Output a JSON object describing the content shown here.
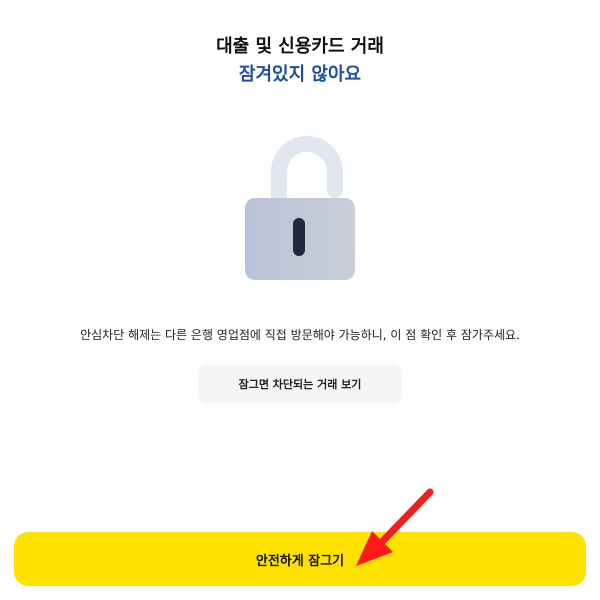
{
  "header": {
    "title": "대출 및 신용카드 거래",
    "status": "잠겨있지 않아요"
  },
  "lock": {
    "icon": "unlocked-padlock-icon",
    "state": "unlocked"
  },
  "description": "안심차단 해제는 다른 은행 영업점에 직접 방문해야 가능하니, 이 점 확인 후 잠가주세요.",
  "buttons": {
    "view_blocked": "잠그면 차단되는 거래 보기",
    "lock_safely": "안전하게 잠그기"
  },
  "annotation": {
    "icon": "red-arrow-icon"
  },
  "colors": {
    "status_blue": "#1f4f9e",
    "primary_yellow": "#ffe100",
    "arrow_red": "#ff1a1a",
    "lock_body_start": "#b9c3d8",
    "lock_body_end": "#c9ced7",
    "shackle": "#e2e6ef",
    "keyhole": "#1f2a40"
  }
}
